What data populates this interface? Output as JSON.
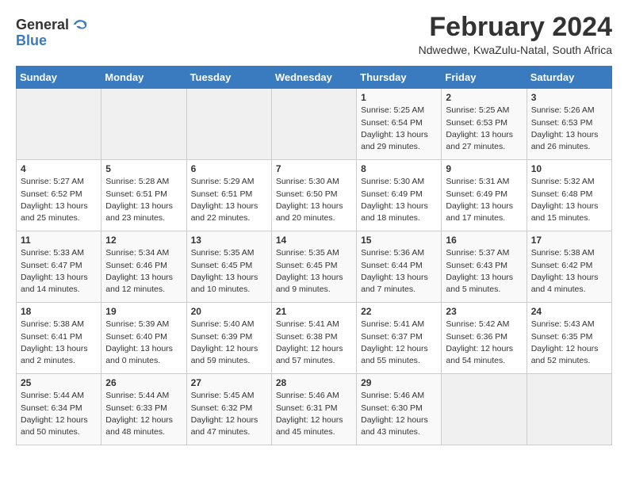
{
  "logo": {
    "general": "General",
    "blue": "Blue"
  },
  "title": "February 2024",
  "subtitle": "Ndwedwe, KwaZulu-Natal, South Africa",
  "days_of_week": [
    "Sunday",
    "Monday",
    "Tuesday",
    "Wednesday",
    "Thursday",
    "Friday",
    "Saturday"
  ],
  "weeks": [
    [
      {
        "num": "",
        "info": "",
        "empty": true
      },
      {
        "num": "",
        "info": "",
        "empty": true
      },
      {
        "num": "",
        "info": "",
        "empty": true
      },
      {
        "num": "",
        "info": "",
        "empty": true
      },
      {
        "num": "1",
        "info": "Sunrise: 5:25 AM\nSunset: 6:54 PM\nDaylight: 13 hours\nand 29 minutes."
      },
      {
        "num": "2",
        "info": "Sunrise: 5:25 AM\nSunset: 6:53 PM\nDaylight: 13 hours\nand 27 minutes."
      },
      {
        "num": "3",
        "info": "Sunrise: 5:26 AM\nSunset: 6:53 PM\nDaylight: 13 hours\nand 26 minutes."
      }
    ],
    [
      {
        "num": "4",
        "info": "Sunrise: 5:27 AM\nSunset: 6:52 PM\nDaylight: 13 hours\nand 25 minutes."
      },
      {
        "num": "5",
        "info": "Sunrise: 5:28 AM\nSunset: 6:51 PM\nDaylight: 13 hours\nand 23 minutes."
      },
      {
        "num": "6",
        "info": "Sunrise: 5:29 AM\nSunset: 6:51 PM\nDaylight: 13 hours\nand 22 minutes."
      },
      {
        "num": "7",
        "info": "Sunrise: 5:30 AM\nSunset: 6:50 PM\nDaylight: 13 hours\nand 20 minutes."
      },
      {
        "num": "8",
        "info": "Sunrise: 5:30 AM\nSunset: 6:49 PM\nDaylight: 13 hours\nand 18 minutes."
      },
      {
        "num": "9",
        "info": "Sunrise: 5:31 AM\nSunset: 6:49 PM\nDaylight: 13 hours\nand 17 minutes."
      },
      {
        "num": "10",
        "info": "Sunrise: 5:32 AM\nSunset: 6:48 PM\nDaylight: 13 hours\nand 15 minutes."
      }
    ],
    [
      {
        "num": "11",
        "info": "Sunrise: 5:33 AM\nSunset: 6:47 PM\nDaylight: 13 hours\nand 14 minutes."
      },
      {
        "num": "12",
        "info": "Sunrise: 5:34 AM\nSunset: 6:46 PM\nDaylight: 13 hours\nand 12 minutes."
      },
      {
        "num": "13",
        "info": "Sunrise: 5:35 AM\nSunset: 6:45 PM\nDaylight: 13 hours\nand 10 minutes."
      },
      {
        "num": "14",
        "info": "Sunrise: 5:35 AM\nSunset: 6:45 PM\nDaylight: 13 hours\nand 9 minutes."
      },
      {
        "num": "15",
        "info": "Sunrise: 5:36 AM\nSunset: 6:44 PM\nDaylight: 13 hours\nand 7 minutes."
      },
      {
        "num": "16",
        "info": "Sunrise: 5:37 AM\nSunset: 6:43 PM\nDaylight: 13 hours\nand 5 minutes."
      },
      {
        "num": "17",
        "info": "Sunrise: 5:38 AM\nSunset: 6:42 PM\nDaylight: 13 hours\nand 4 minutes."
      }
    ],
    [
      {
        "num": "18",
        "info": "Sunrise: 5:38 AM\nSunset: 6:41 PM\nDaylight: 13 hours\nand 2 minutes."
      },
      {
        "num": "19",
        "info": "Sunrise: 5:39 AM\nSunset: 6:40 PM\nDaylight: 13 hours\nand 0 minutes."
      },
      {
        "num": "20",
        "info": "Sunrise: 5:40 AM\nSunset: 6:39 PM\nDaylight: 12 hours\nand 59 minutes."
      },
      {
        "num": "21",
        "info": "Sunrise: 5:41 AM\nSunset: 6:38 PM\nDaylight: 12 hours\nand 57 minutes."
      },
      {
        "num": "22",
        "info": "Sunrise: 5:41 AM\nSunset: 6:37 PM\nDaylight: 12 hours\nand 55 minutes."
      },
      {
        "num": "23",
        "info": "Sunrise: 5:42 AM\nSunset: 6:36 PM\nDaylight: 12 hours\nand 54 minutes."
      },
      {
        "num": "24",
        "info": "Sunrise: 5:43 AM\nSunset: 6:35 PM\nDaylight: 12 hours\nand 52 minutes."
      }
    ],
    [
      {
        "num": "25",
        "info": "Sunrise: 5:44 AM\nSunset: 6:34 PM\nDaylight: 12 hours\nand 50 minutes."
      },
      {
        "num": "26",
        "info": "Sunrise: 5:44 AM\nSunset: 6:33 PM\nDaylight: 12 hours\nand 48 minutes."
      },
      {
        "num": "27",
        "info": "Sunrise: 5:45 AM\nSunset: 6:32 PM\nDaylight: 12 hours\nand 47 minutes."
      },
      {
        "num": "28",
        "info": "Sunrise: 5:46 AM\nSunset: 6:31 PM\nDaylight: 12 hours\nand 45 minutes."
      },
      {
        "num": "29",
        "info": "Sunrise: 5:46 AM\nSunset: 6:30 PM\nDaylight: 12 hours\nand 43 minutes."
      },
      {
        "num": "",
        "info": "",
        "empty": true
      },
      {
        "num": "",
        "info": "",
        "empty": true
      }
    ]
  ]
}
